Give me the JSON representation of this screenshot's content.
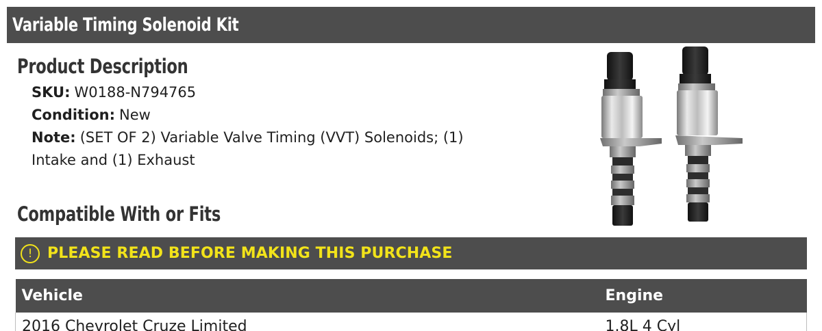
{
  "header": {
    "title": "Variable Timing Solenoid Kit"
  },
  "product_description": {
    "heading": "Product Description",
    "sku_label": "SKU:",
    "sku_value": "W0188-N794765",
    "condition_label": "Condition:",
    "condition_value": "New",
    "note_label": "Note:",
    "note_value": "(SET OF 2) Variable Valve Timing (VVT) Solenoids; (1) Intake and (1) Exhaust"
  },
  "product_image": {
    "icon": "vvt-solenoid-pair-photo"
  },
  "compatibility": {
    "heading": "Compatible With or Fits",
    "notice": {
      "icon": "exclamation-circle-icon",
      "icon_glyph": "!",
      "text": "PLEASE READ BEFORE MAKING THIS PURCHASE",
      "color": "#f2e31a"
    },
    "table": {
      "columns": [
        "Vehicle",
        "Engine"
      ],
      "rows": [
        {
          "vehicle": "2016 Chevrolet Cruze Limited",
          "engine": "1.8L 4 Cyl"
        }
      ]
    }
  },
  "colors": {
    "header_bg": "#4d4d4d",
    "heading_text": "#333333",
    "notice_text": "#f2e31a"
  }
}
